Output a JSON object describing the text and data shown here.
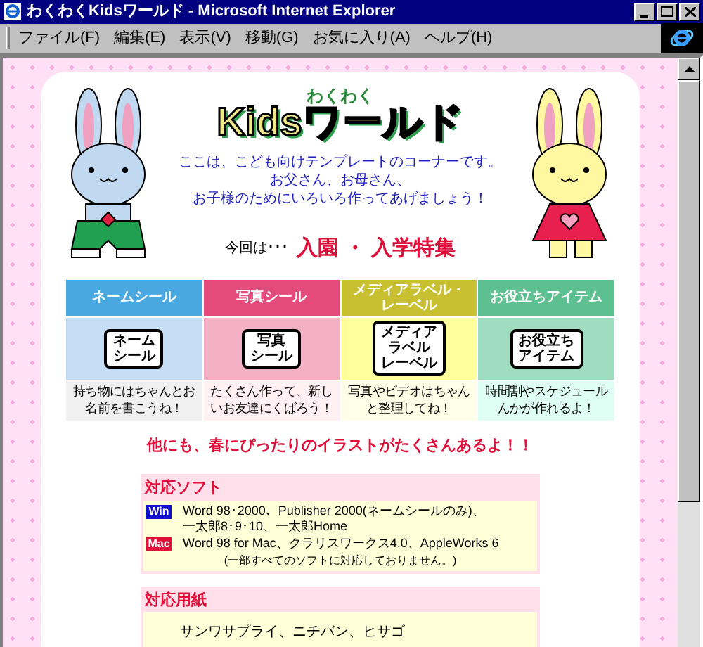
{
  "window": {
    "title": "わくわくKidsワールド - Microsoft Internet Explorer"
  },
  "menu": [
    "ファイル(F)",
    "編集(E)",
    "表示(V)",
    "移動(G)",
    "お気に入り(A)",
    "ヘルプ(H)"
  ],
  "logo": {
    "ruby": "わくわく",
    "title": "Kidsワールド"
  },
  "intro": [
    "ここは、こども向けテンプレートのコーナーです。",
    "お父さん、お母さん、",
    "お子様のためにいろいろ作ってあげましょう！"
  ],
  "feature": {
    "lead": "今回は･･･",
    "title": "入園 ・ 入学特集"
  },
  "categories": [
    {
      "header": "ネームシール",
      "label": [
        "ネーム",
        "シール"
      ],
      "description": "持ち物にはちゃんとお名前を書こうね！",
      "color": "#4aa8e0"
    },
    {
      "header": "写真シール",
      "label": [
        "写真",
        "シール"
      ],
      "description": "たくさん作って、新しいお友達にくばろう！",
      "color": "#e44a7c"
    },
    {
      "header": "メディアラベル・レーベル",
      "label": [
        "メディア",
        "ラベル",
        "レーベル"
      ],
      "description": "写真やビデオはちゃんと整理してね！",
      "color": "#c8c030"
    },
    {
      "header": "お役立ちアイテム",
      "label": [
        "お役立ち",
        "アイテム"
      ],
      "description": "時間割やスケジュールんかが作れるよ！",
      "color": "#5cc090"
    }
  ],
  "tagline": "他にも、春にぴったりのイラストがたくさんあるよ！！",
  "software": {
    "heading": "対応ソフト",
    "entries": [
      {
        "platform": "Win",
        "lines": [
          "Word 98･2000、Publisher 2000(ネームシールのみ)、",
          "一太郎8･9･10、一太郎Home"
        ]
      },
      {
        "platform": "Mac",
        "lines": [
          "Word 98 for Mac、クラリスワークス4.0、AppleWorks 6"
        ]
      }
    ],
    "note": "(一部すべてのソフトに対応しておりません。)"
  },
  "paper": {
    "heading": "対応用紙",
    "text": "サンワサプライ、ニチバン、ヒサゴ"
  }
}
